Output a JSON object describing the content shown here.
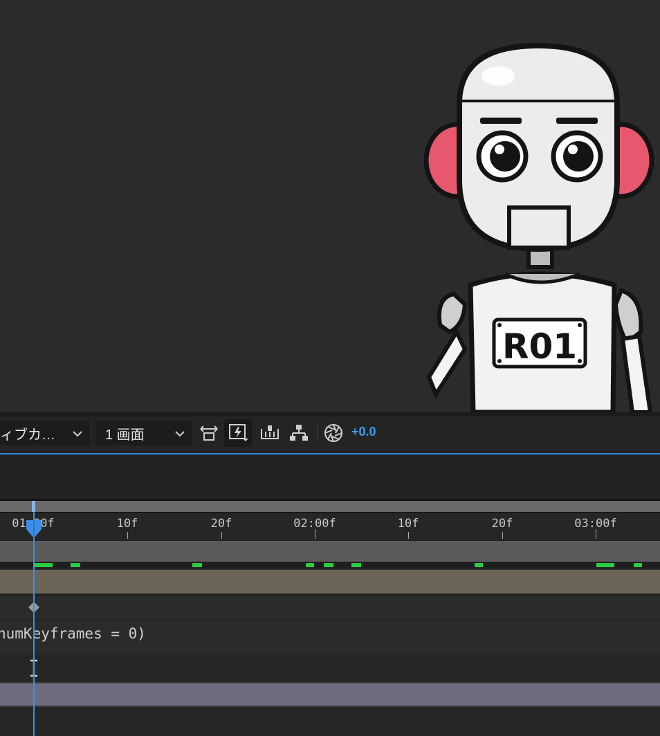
{
  "toolbar": {
    "view_dropdown": "ィブカ…",
    "layout_dropdown": "1 画面",
    "exposure_value": "+0.0"
  },
  "icons": {
    "chevron": "chevron-down-icon",
    "reset_exposure": "aperture-icon",
    "toggle_view": "toggle-view-icon",
    "fast_preview": "fast-preview-icon",
    "timeline": "timeline-icon",
    "flowchart": "flowchart-icon"
  },
  "artwork": {
    "badge_text": "R01"
  },
  "timeline": {
    "ruler_labels": [
      "01:00f",
      "10f",
      "20f",
      "02:00f",
      "10f",
      "20f",
      "03:00f"
    ],
    "expression_text": "numKeyframes = 0)",
    "current_time": "01:00f"
  },
  "colors": {
    "accent": "#3b8fe8",
    "marker_green": "#2ecc40",
    "layer_bar": "#6c6457",
    "purple_bar": "#6c6c7e"
  }
}
